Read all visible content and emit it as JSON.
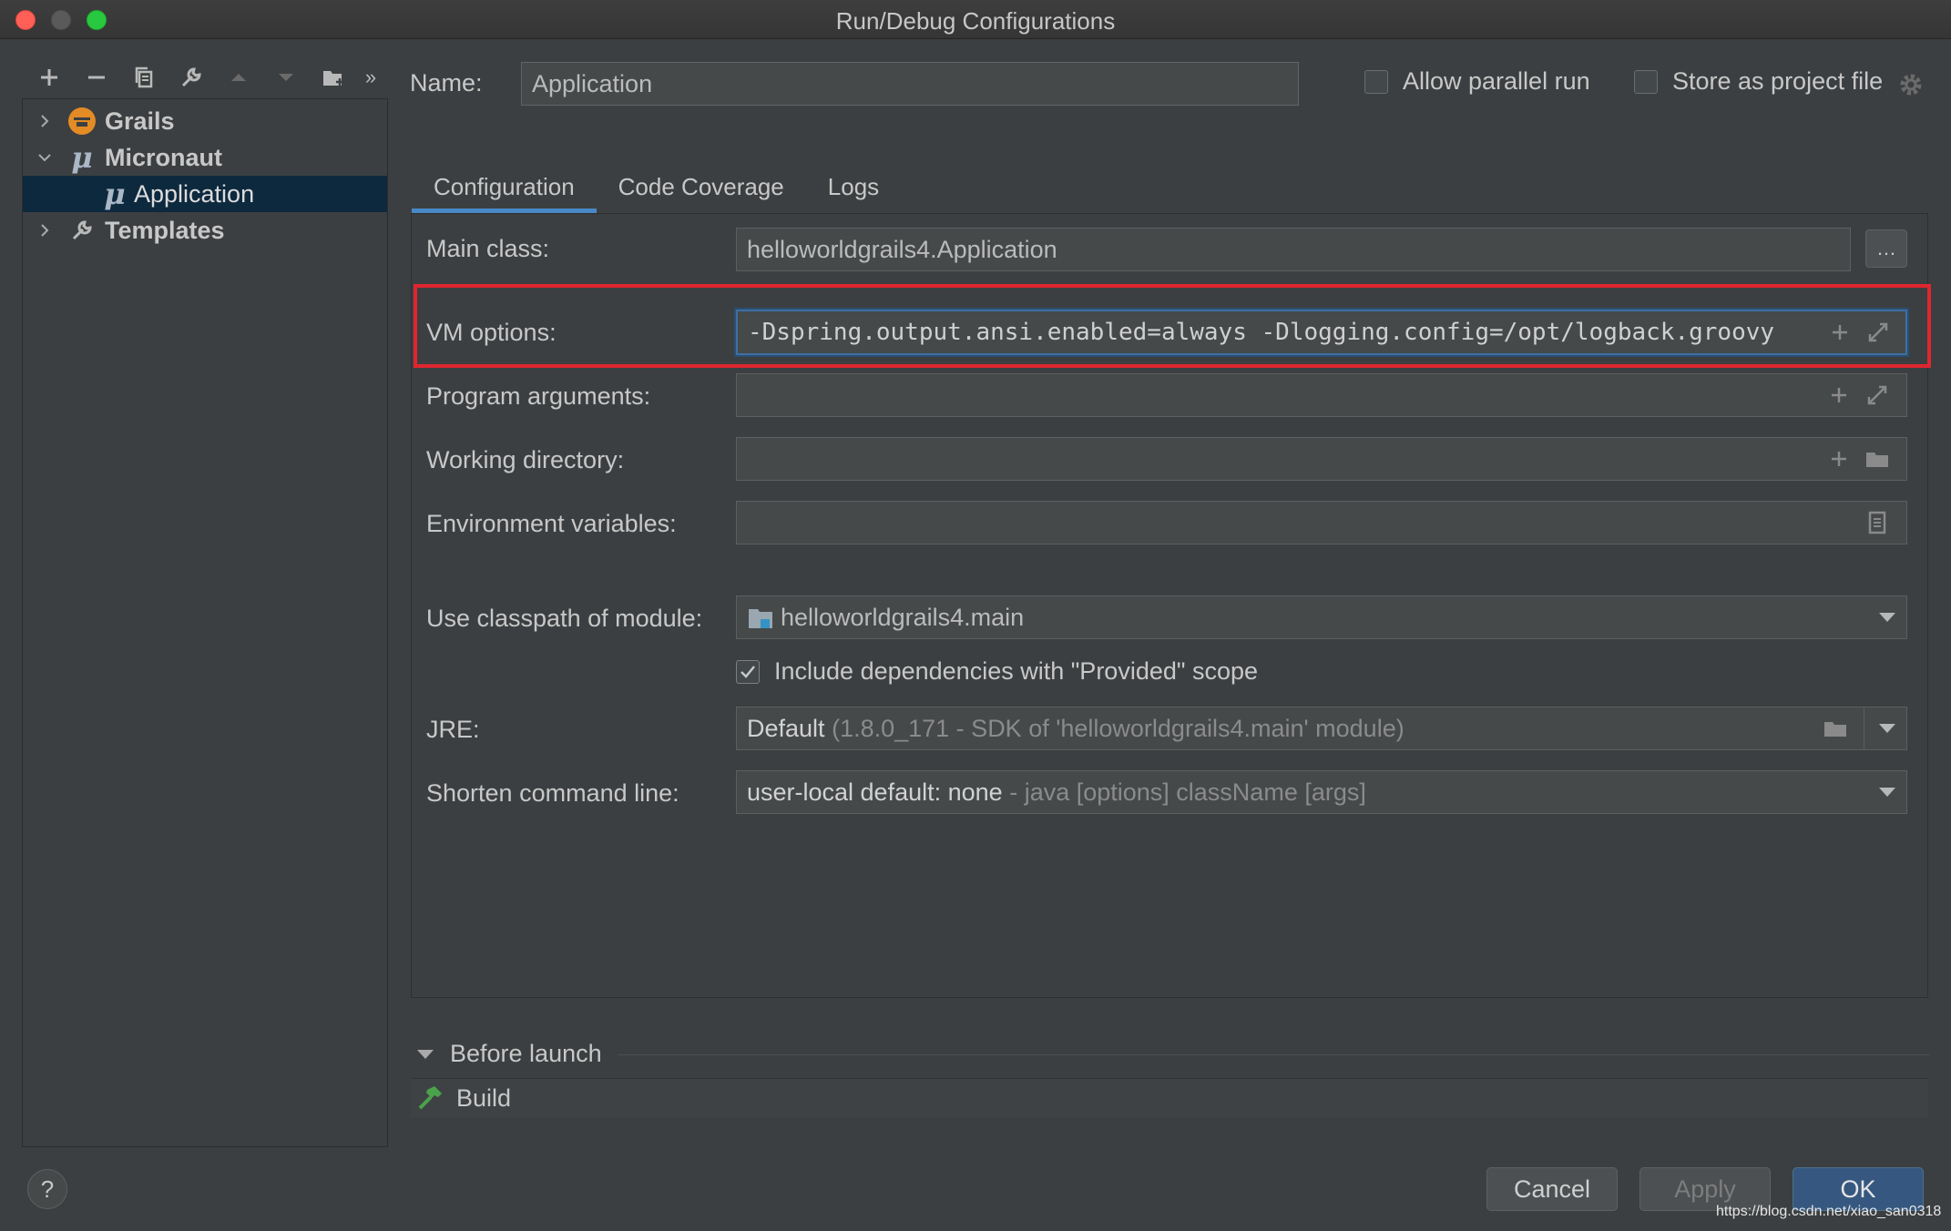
{
  "window": {
    "title": "Run/Debug Configurations"
  },
  "sidebar": {
    "toolbar": [
      "add-icon",
      "remove-icon",
      "copy-icon",
      "wrench-icon",
      "move-up-icon",
      "move-down-icon",
      "new-folder-icon",
      "more-icon"
    ],
    "tree": [
      {
        "label": "Grails",
        "icon": "grails-icon",
        "expanded": false
      },
      {
        "label": "Micronaut",
        "icon": "micronaut-icon",
        "expanded": true
      },
      {
        "label": "Application",
        "icon": "micronaut-icon",
        "selected": true
      },
      {
        "label": "Templates",
        "icon": "wrench-icon",
        "expanded": false
      }
    ]
  },
  "header": {
    "name_label": "Name:",
    "name_value": "Application",
    "allow_parallel_run": {
      "label": "Allow parallel run",
      "checked": false
    },
    "store_as_project_file": {
      "label": "Store as project file",
      "checked": false
    }
  },
  "tabs": [
    {
      "label": "Configuration",
      "active": true
    },
    {
      "label": "Code Coverage"
    },
    {
      "label": "Logs"
    }
  ],
  "config": {
    "main_class": {
      "label": "Main class:",
      "value": "helloworldgrails4.Application"
    },
    "vm_options": {
      "label": "VM options:",
      "value": "-Dspring.output.ansi.enabled=always -Dlogging.config=/opt/logback.groovy"
    },
    "program_arguments": {
      "label": "Program arguments:",
      "value": ""
    },
    "working_directory": {
      "label": "Working directory:",
      "value": ""
    },
    "environment_variables": {
      "label": "Environment variables:",
      "value": ""
    },
    "classpath_module": {
      "label": "Use classpath of module:",
      "value": "helloworldgrails4.main"
    },
    "include_provided": {
      "label": "Include dependencies with \"Provided\" scope",
      "checked": true
    },
    "jre": {
      "label": "JRE:",
      "value": "Default",
      "detail": "(1.8.0_171 - SDK of 'helloworldgrails4.main' module)"
    },
    "shorten_command_line": {
      "label": "Shorten command line:",
      "value": "user-local default: none",
      "detail": "- java [options] className [args]"
    }
  },
  "before_launch": {
    "label": "Before launch",
    "tasks": [
      {
        "label": "Build"
      }
    ]
  },
  "buttons": {
    "help": "?",
    "cancel": "Cancel",
    "apply": "Apply",
    "ok": "OK"
  },
  "watermark": "https://blog.csdn.net/xiao_san0318",
  "colors": {
    "background": "#3c3f41",
    "accent": "#4a88c7",
    "highlight_border": "#e0262f",
    "selection": "#0d293e",
    "primary_button": "#365880"
  }
}
